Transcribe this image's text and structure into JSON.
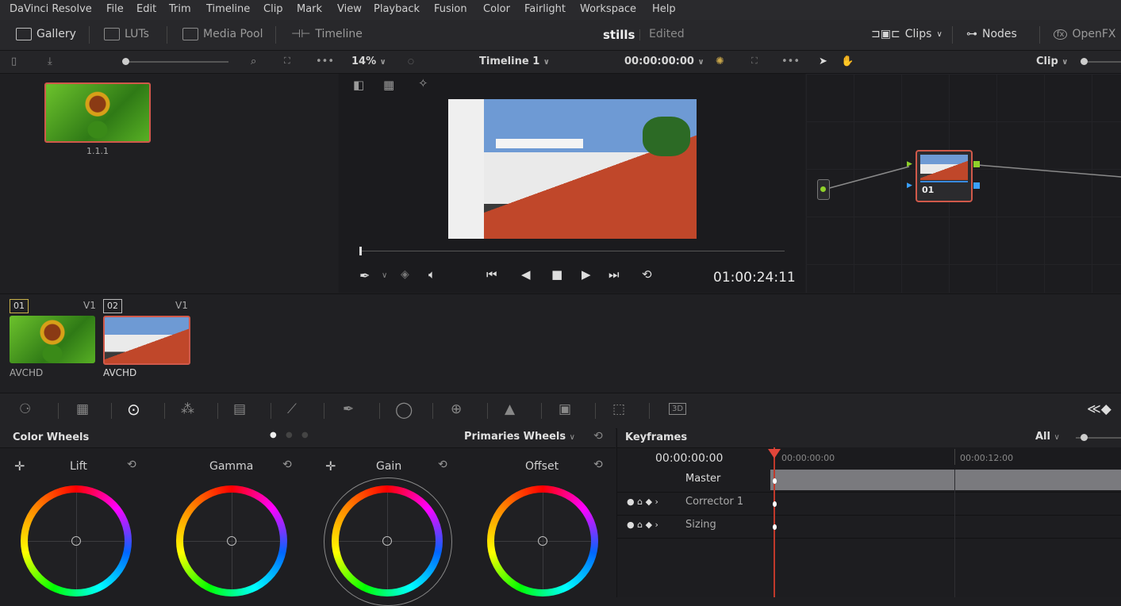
{
  "menu": [
    "DaVinci Resolve",
    "File",
    "Edit",
    "Trim",
    "Timeline",
    "Clip",
    "Mark",
    "View",
    "Playback",
    "Fusion",
    "Color",
    "Fairlight",
    "Workspace",
    "Help"
  ],
  "toolbar": {
    "gallery": "Gallery",
    "luts": "LUTs",
    "media_pool": "Media Pool",
    "timeline": "Timeline",
    "project": "stills",
    "status": "Edited",
    "clips": "Clips",
    "nodes": "Nodes",
    "openfx": "OpenFX"
  },
  "viewer": {
    "zoom": "14%",
    "timeline_name": "Timeline 1",
    "timecode_top": "00:00:00:00",
    "timecode": "01:00:24:11"
  },
  "node_mode": "Clip",
  "gallery": {
    "still_label": "1.1.1"
  },
  "clips": [
    {
      "num": "01",
      "track": "V1",
      "codec": "AVCHD"
    },
    {
      "num": "02",
      "track": "V1",
      "codec": "AVCHD"
    }
  ],
  "node": {
    "label": "01"
  },
  "color_wheels": {
    "title": "Color Wheels",
    "mode": "Primaries Wheels",
    "wheels": [
      "Lift",
      "Gamma",
      "Gain",
      "Offset"
    ]
  },
  "keyframes": {
    "title": "Keyframes",
    "filter": "All",
    "timecode": "00:00:00:00",
    "ruler_start": "00:00:00:00",
    "ruler_mid": "00:00:12:00",
    "rows": [
      "Master",
      "Corrector 1",
      "Sizing"
    ]
  },
  "colors": {
    "accent": "#e0453a",
    "selected_border": "#d0594a",
    "bg": "#1e1e21"
  }
}
